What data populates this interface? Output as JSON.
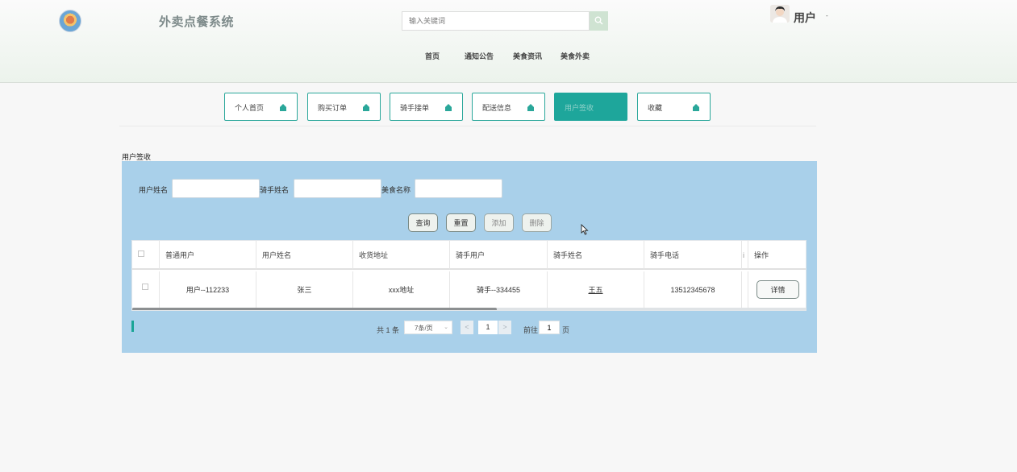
{
  "header": {
    "site_title": "外卖点餐系统",
    "search_placeholder": "输入关键词",
    "user_name": "用户",
    "caret": "-"
  },
  "nav": {
    "items": [
      "首页",
      "通知公告",
      "美食资讯",
      "美食外卖"
    ]
  },
  "tabs": [
    {
      "label": "个人首页",
      "active": false
    },
    {
      "label": "购买订单",
      "active": false
    },
    {
      "label": "骑手接单",
      "active": false
    },
    {
      "label": "配送信息",
      "active": false
    },
    {
      "label": "用户签收",
      "active": true
    },
    {
      "label": "收藏",
      "active": false
    }
  ],
  "section_title": "用户签收",
  "filters": {
    "user_name_label": "用户姓名",
    "rider_name_label": "骑手姓名",
    "food_name_label": "美食名称"
  },
  "actions": {
    "query": "查询",
    "reset": "重置",
    "add": "添加",
    "delete": "删除"
  },
  "table": {
    "headers": [
      "普通用户",
      "用户姓名",
      "收货地址",
      "骑手用户",
      "骑手姓名",
      "骑手电话",
      "i",
      "操作"
    ],
    "rows": [
      {
        "user": "用户--112233",
        "user_name": "张三",
        "address": "xxx地址",
        "rider_user": "骑手--334455",
        "rider_name": "王五",
        "rider_phone": "13512345678",
        "detail": "详情"
      }
    ]
  },
  "pager": {
    "total": "共 1 条",
    "page_size": "7条/页",
    "prev": "<",
    "next": ">",
    "current_page": "1",
    "goto_label": "前往",
    "goto_value": "1",
    "page_suffix": "页"
  },
  "colors": {
    "accent": "#1ea69b",
    "panel_bg": "#a9d0ea"
  }
}
